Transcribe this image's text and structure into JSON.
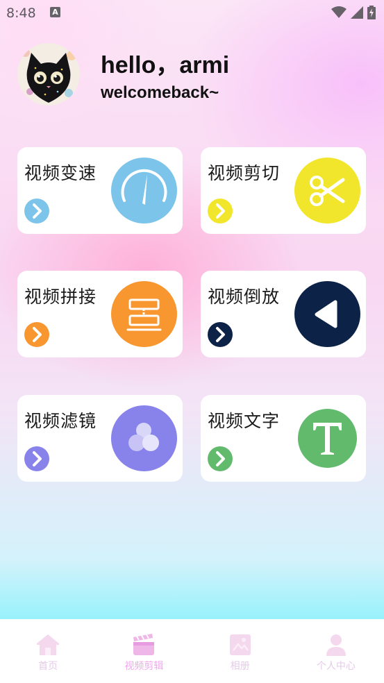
{
  "status_bar": {
    "time": "8:48",
    "notification_icon_letter": "A",
    "icons": [
      "wifi-icon",
      "signal-icon",
      "battery-icon"
    ]
  },
  "header": {
    "greeting": "hello，armi",
    "subtitle": "welcomeback~"
  },
  "cards": [
    {
      "title": "视频变速",
      "color": "#7cc4ea",
      "icon": "speedometer-icon"
    },
    {
      "title": "视频剪切",
      "color": "#f2e62c",
      "icon": "scissors-icon"
    },
    {
      "title": "视频拼接",
      "color": "#f8962f",
      "icon": "splice-icon"
    },
    {
      "title": "视频倒放",
      "color": "#0d2247",
      "icon": "rewind-icon"
    },
    {
      "title": "视频滤镜",
      "color": "#8883eb",
      "icon": "filter-icon"
    },
    {
      "title": "视频文字",
      "color": "#62bb6c",
      "icon": "text-icon"
    }
  ],
  "bottom_nav": {
    "items": [
      {
        "label": "首页",
        "icon": "home-icon",
        "active": false
      },
      {
        "label": "视频剪辑",
        "icon": "clapperboard-icon",
        "active": true
      },
      {
        "label": "相册",
        "icon": "album-icon",
        "active": false
      },
      {
        "label": "个人中心",
        "icon": "person-icon",
        "active": false
      }
    ]
  }
}
